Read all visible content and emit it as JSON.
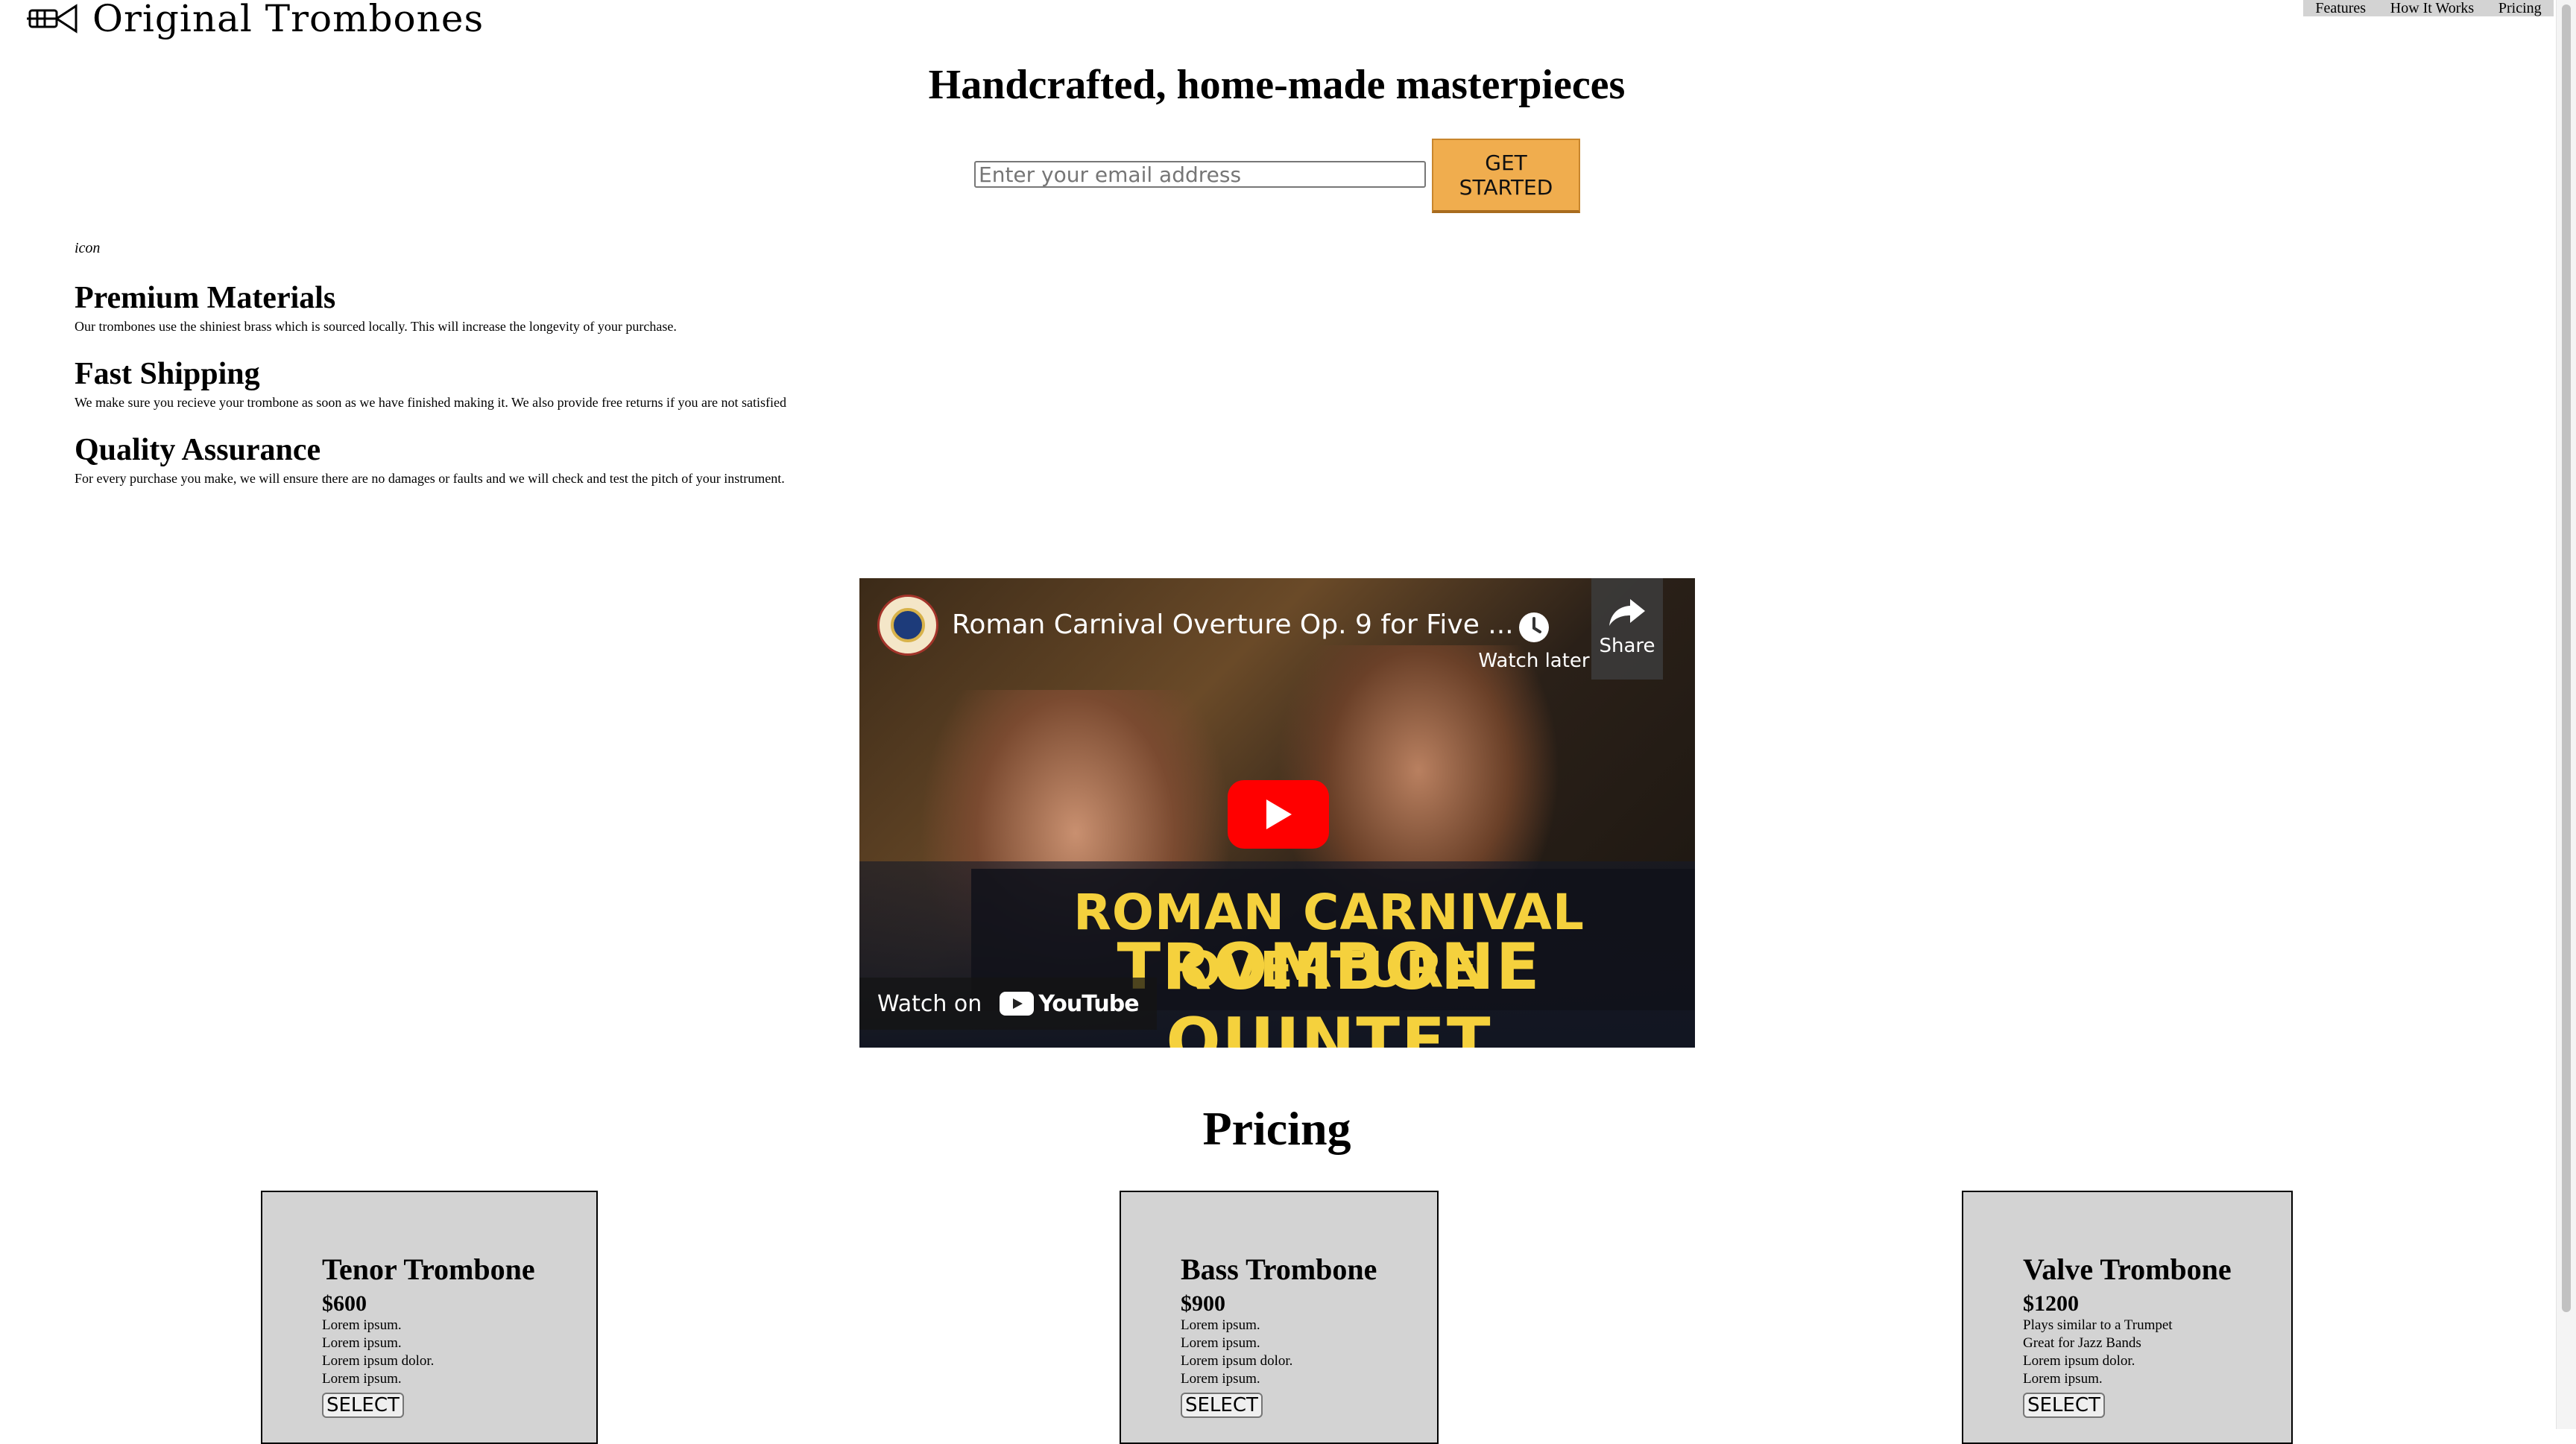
{
  "header": {
    "brand": "Original Trombones",
    "nav": [
      "Features",
      "How It Works",
      "Pricing"
    ]
  },
  "hero": {
    "title": "Handcrafted, home-made masterpieces",
    "email_placeholder": "Enter your email address",
    "cta_label": "GET STARTED"
  },
  "features": {
    "icon_alt": "icon",
    "items": [
      {
        "title": "Premium Materials",
        "description": "Our trombones use the shiniest brass which is sourced locally. This will increase the longevity of your purchase."
      },
      {
        "title": "Fast Shipping",
        "description": "We make sure you recieve your trombone as soon as we have finished making it. We also provide free returns if you are not satisfied"
      },
      {
        "title": "Quality Assurance",
        "description": "For every purchase you make, we will ensure there are no damages or faults and we will check and test the pitch of your instrument."
      }
    ]
  },
  "video": {
    "title": "Roman Carnival Overture Op. 9 for Five ...",
    "watch_later": "Watch later",
    "share": "Share",
    "banner_line1": "ROMAN CARNIVAL OVERTURE",
    "banner_line2": "TROMBONE QUINTET",
    "watch_on": "Watch on",
    "youtube": "YouTube"
  },
  "pricing": {
    "title": "Pricing",
    "plans": [
      {
        "name": "Tenor Trombone",
        "price": "$600",
        "features": [
          "Lorem ipsum.",
          "Lorem ipsum.",
          "Lorem ipsum dolor.",
          "Lorem ipsum."
        ],
        "button": "SELECT"
      },
      {
        "name": "Bass Trombone",
        "price": "$900",
        "features": [
          "Lorem ipsum.",
          "Lorem ipsum.",
          "Lorem ipsum dolor.",
          "Lorem ipsum."
        ],
        "button": "SELECT"
      },
      {
        "name": "Valve Trombone",
        "price": "$1200",
        "features": [
          "Plays similar to a Trumpet",
          "Great for Jazz Bands",
          "Lorem ipsum dolor.",
          "Lorem ipsum."
        ],
        "button": "SELECT"
      }
    ]
  },
  "colors": {
    "cta": "#f0ad4e",
    "nav_bg": "#d3d3d3",
    "card_bg": "#d3d3d3",
    "youtube_red": "#ff0000",
    "banner_text": "#f5d13d"
  }
}
